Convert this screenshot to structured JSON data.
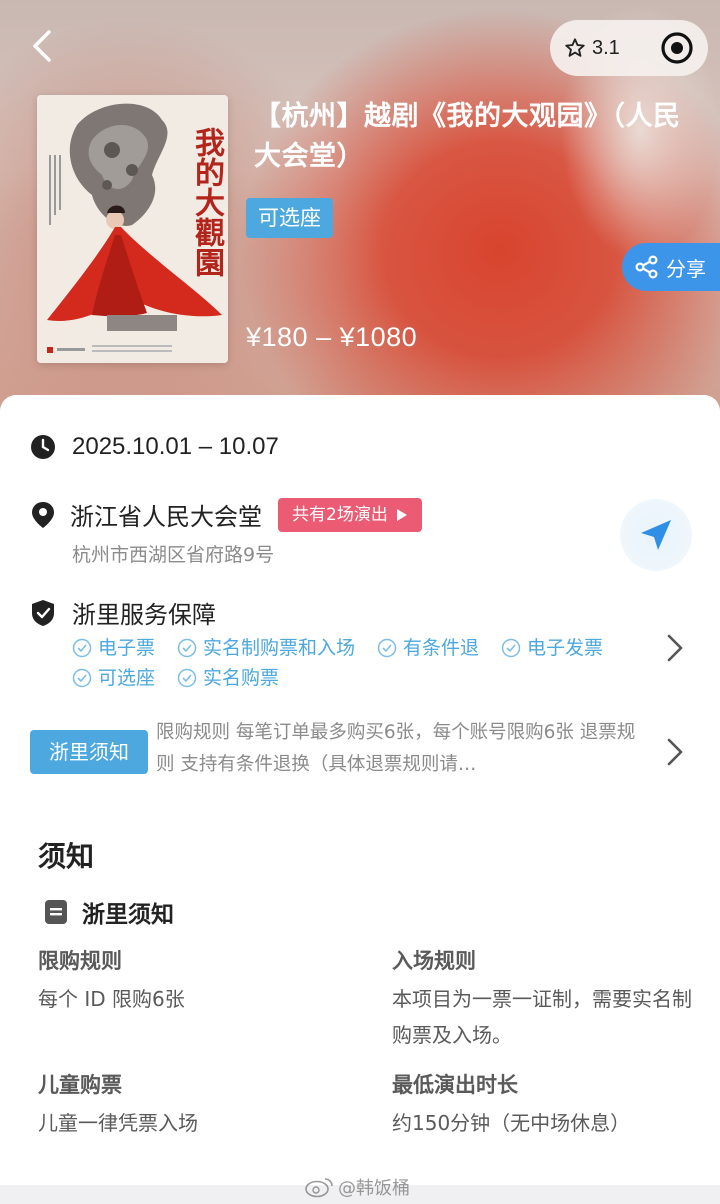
{
  "header": {
    "rating": "3.1",
    "poster_title": "我的大觀園",
    "title": "【杭州】越剧《我的大观园》（人民大会堂）",
    "seat_tag": "可选座",
    "share_label": "分享",
    "price": "¥180 – ¥1080"
  },
  "info": {
    "date": "2025.10.01 – 10.07",
    "venue_name": "浙江省人民大会堂",
    "shows_tag": "共有2场演出",
    "venue_address": "杭州市西湖区省府路9号",
    "service_title": "浙里服务保障",
    "service_items": [
      "电子票",
      "实名制购票和入场",
      "有条件退",
      "电子发票",
      "可选座",
      "实名购票"
    ],
    "notice_tag": "浙里须知",
    "notice_text": "限购规则 每笔订单最多购买6张，每个账号限购6张 退票规则 支持有条件退换（具体退票规则请…"
  },
  "notice_section": {
    "title": "须知",
    "subtitle": "浙里须知",
    "rules": [
      {
        "title": "限购规则",
        "value": "每个 ID 限购6张"
      },
      {
        "title": "入场规则",
        "value": "本项目为一票一证制，需要实名制购票及入场。"
      },
      {
        "title": "儿童购票",
        "value": "儿童一律凭票入场"
      },
      {
        "title": "最低演出时长",
        "value": "约150分钟（无中场休息）"
      }
    ]
  },
  "watermark": "@韩饭桶",
  "colors": {
    "accent_blue": "#4ca8de",
    "share_blue": "#3d95ea",
    "shows_pink": "#ec5b74"
  }
}
